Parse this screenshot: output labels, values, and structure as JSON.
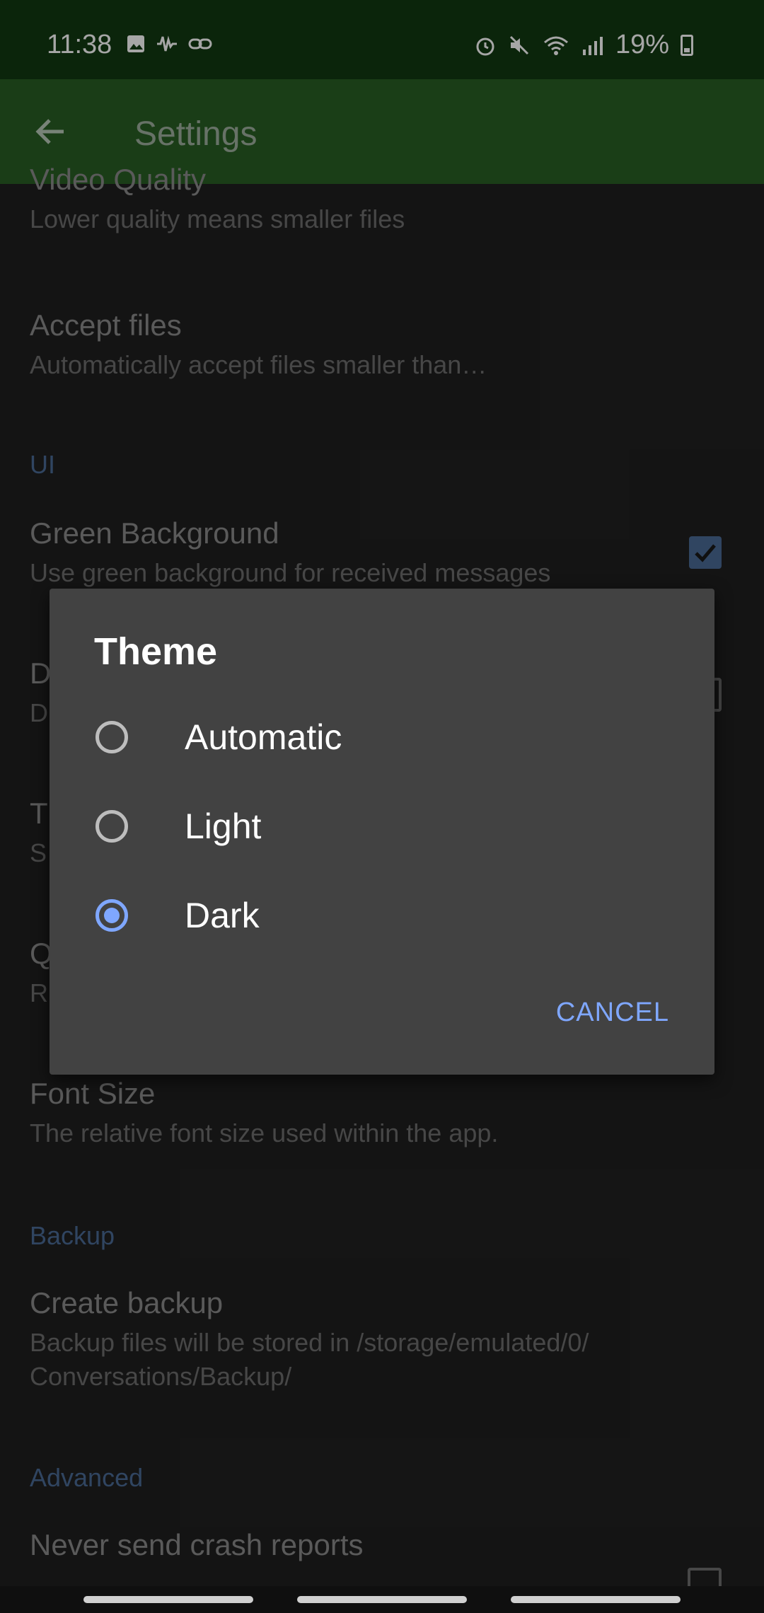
{
  "status_bar": {
    "time": "11:38",
    "battery": "19%",
    "icons_left": [
      "image-icon",
      "waveform-icon",
      "link-icon"
    ],
    "icons_right": [
      "alarm-icon",
      "mute-icon",
      "wifi-icon",
      "signal-icon",
      "battery-icon"
    ]
  },
  "app_bar": {
    "title": "Settings"
  },
  "settings": {
    "video_quality": {
      "title": "Video Quality",
      "summary": "Lower quality means smaller files"
    },
    "accept_files": {
      "title": "Accept files",
      "summary": "Automatically accept files smaller than…"
    },
    "ui_header": "UI",
    "green_background": {
      "title": "Green Background",
      "summary": "Use green background for received messages",
      "checked": true
    },
    "partial_d": {
      "title": "D",
      "summary": "D"
    },
    "partial_t": {
      "title": "T",
      "summary": "S"
    },
    "partial_q": {
      "title": "Q",
      "summary": "R"
    },
    "font_size": {
      "title": "Font Size",
      "summary": "The relative font size used within the app."
    },
    "backup_header": "Backup",
    "create_backup": {
      "title": "Create backup",
      "summary": "Backup files will be stored in /storage/emulated/0/ Conversations/Backup/"
    },
    "advanced_header": "Advanced",
    "never_send_crash": {
      "title": "Never send crash reports"
    }
  },
  "dialog": {
    "title": "Theme",
    "options": [
      {
        "label": "Automatic",
        "selected": false
      },
      {
        "label": "Light",
        "selected": false
      },
      {
        "label": "Dark",
        "selected": true
      }
    ],
    "cancel_label": "CANCEL"
  },
  "colors": {
    "status_bar": "#123a12",
    "app_bar": "#285f24",
    "accent": "#7fa7ff",
    "dialog_bg": "#424242"
  }
}
